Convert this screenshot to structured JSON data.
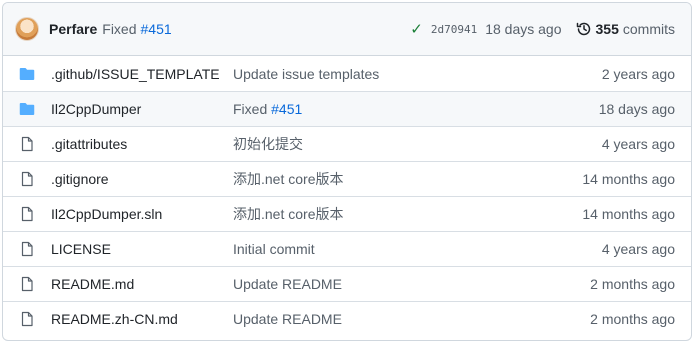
{
  "latest_commit": {
    "author": "Perfare",
    "message": "Fixed",
    "link": "#451",
    "sha": "2d70941",
    "time": "18 days ago",
    "commits_count": "355",
    "commits_label": "commits"
  },
  "icons": {
    "avatar": "avatar",
    "check": "check-icon",
    "history": "history-icon",
    "folder": "folder-icon",
    "file": "file-icon"
  },
  "colors": {
    "folder": "#54aeff",
    "link": "#0969da",
    "check": "#1a7f37"
  },
  "files": [
    {
      "type": "folder",
      "name": ".github/ISSUE_TEMPLATE",
      "message": "Update issue templates",
      "link": "",
      "age": "2 years ago"
    },
    {
      "type": "folder",
      "name": "Il2CppDumper",
      "message": "Fixed",
      "link": "#451",
      "age": "18 days ago"
    },
    {
      "type": "file",
      "name": ".gitattributes",
      "message": "初始化提交",
      "link": "",
      "age": "4 years ago"
    },
    {
      "type": "file",
      "name": ".gitignore",
      "message": "添加.net core版本",
      "link": "",
      "age": "14 months ago"
    },
    {
      "type": "file",
      "name": "Il2CppDumper.sln",
      "message": "添加.net core版本",
      "link": "",
      "age": "14 months ago"
    },
    {
      "type": "file",
      "name": "LICENSE",
      "message": "Initial commit",
      "link": "",
      "age": "4 years ago"
    },
    {
      "type": "file",
      "name": "README.md",
      "message": "Update README",
      "link": "",
      "age": "2 months ago"
    },
    {
      "type": "file",
      "name": "README.zh-CN.md",
      "message": "Update README",
      "link": "",
      "age": "2 months ago"
    }
  ]
}
